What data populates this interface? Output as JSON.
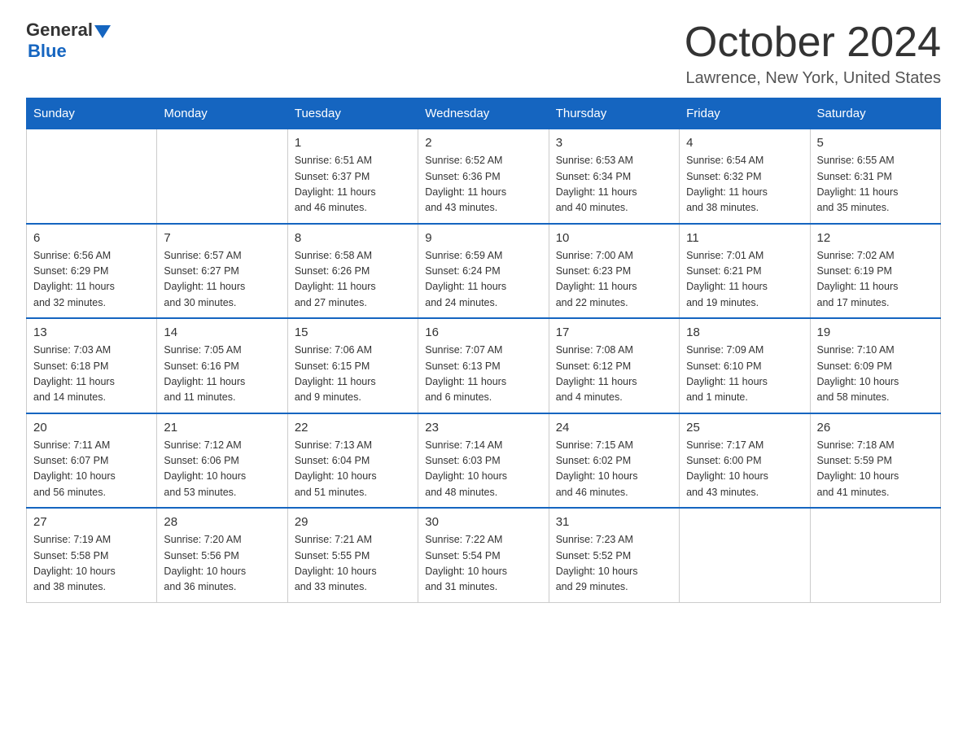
{
  "header": {
    "logo_general": "General",
    "logo_blue": "Blue",
    "month_title": "October 2024",
    "location": "Lawrence, New York, United States"
  },
  "calendar": {
    "days_of_week": [
      "Sunday",
      "Monday",
      "Tuesday",
      "Wednesday",
      "Thursday",
      "Friday",
      "Saturday"
    ],
    "weeks": [
      [
        {
          "day": "",
          "info": ""
        },
        {
          "day": "",
          "info": ""
        },
        {
          "day": "1",
          "info": "Sunrise: 6:51 AM\nSunset: 6:37 PM\nDaylight: 11 hours\nand 46 minutes."
        },
        {
          "day": "2",
          "info": "Sunrise: 6:52 AM\nSunset: 6:36 PM\nDaylight: 11 hours\nand 43 minutes."
        },
        {
          "day": "3",
          "info": "Sunrise: 6:53 AM\nSunset: 6:34 PM\nDaylight: 11 hours\nand 40 minutes."
        },
        {
          "day": "4",
          "info": "Sunrise: 6:54 AM\nSunset: 6:32 PM\nDaylight: 11 hours\nand 38 minutes."
        },
        {
          "day": "5",
          "info": "Sunrise: 6:55 AM\nSunset: 6:31 PM\nDaylight: 11 hours\nand 35 minutes."
        }
      ],
      [
        {
          "day": "6",
          "info": "Sunrise: 6:56 AM\nSunset: 6:29 PM\nDaylight: 11 hours\nand 32 minutes."
        },
        {
          "day": "7",
          "info": "Sunrise: 6:57 AM\nSunset: 6:27 PM\nDaylight: 11 hours\nand 30 minutes."
        },
        {
          "day": "8",
          "info": "Sunrise: 6:58 AM\nSunset: 6:26 PM\nDaylight: 11 hours\nand 27 minutes."
        },
        {
          "day": "9",
          "info": "Sunrise: 6:59 AM\nSunset: 6:24 PM\nDaylight: 11 hours\nand 24 minutes."
        },
        {
          "day": "10",
          "info": "Sunrise: 7:00 AM\nSunset: 6:23 PM\nDaylight: 11 hours\nand 22 minutes."
        },
        {
          "day": "11",
          "info": "Sunrise: 7:01 AM\nSunset: 6:21 PM\nDaylight: 11 hours\nand 19 minutes."
        },
        {
          "day": "12",
          "info": "Sunrise: 7:02 AM\nSunset: 6:19 PM\nDaylight: 11 hours\nand 17 minutes."
        }
      ],
      [
        {
          "day": "13",
          "info": "Sunrise: 7:03 AM\nSunset: 6:18 PM\nDaylight: 11 hours\nand 14 minutes."
        },
        {
          "day": "14",
          "info": "Sunrise: 7:05 AM\nSunset: 6:16 PM\nDaylight: 11 hours\nand 11 minutes."
        },
        {
          "day": "15",
          "info": "Sunrise: 7:06 AM\nSunset: 6:15 PM\nDaylight: 11 hours\nand 9 minutes."
        },
        {
          "day": "16",
          "info": "Sunrise: 7:07 AM\nSunset: 6:13 PM\nDaylight: 11 hours\nand 6 minutes."
        },
        {
          "day": "17",
          "info": "Sunrise: 7:08 AM\nSunset: 6:12 PM\nDaylight: 11 hours\nand 4 minutes."
        },
        {
          "day": "18",
          "info": "Sunrise: 7:09 AM\nSunset: 6:10 PM\nDaylight: 11 hours\nand 1 minute."
        },
        {
          "day": "19",
          "info": "Sunrise: 7:10 AM\nSunset: 6:09 PM\nDaylight: 10 hours\nand 58 minutes."
        }
      ],
      [
        {
          "day": "20",
          "info": "Sunrise: 7:11 AM\nSunset: 6:07 PM\nDaylight: 10 hours\nand 56 minutes."
        },
        {
          "day": "21",
          "info": "Sunrise: 7:12 AM\nSunset: 6:06 PM\nDaylight: 10 hours\nand 53 minutes."
        },
        {
          "day": "22",
          "info": "Sunrise: 7:13 AM\nSunset: 6:04 PM\nDaylight: 10 hours\nand 51 minutes."
        },
        {
          "day": "23",
          "info": "Sunrise: 7:14 AM\nSunset: 6:03 PM\nDaylight: 10 hours\nand 48 minutes."
        },
        {
          "day": "24",
          "info": "Sunrise: 7:15 AM\nSunset: 6:02 PM\nDaylight: 10 hours\nand 46 minutes."
        },
        {
          "day": "25",
          "info": "Sunrise: 7:17 AM\nSunset: 6:00 PM\nDaylight: 10 hours\nand 43 minutes."
        },
        {
          "day": "26",
          "info": "Sunrise: 7:18 AM\nSunset: 5:59 PM\nDaylight: 10 hours\nand 41 minutes."
        }
      ],
      [
        {
          "day": "27",
          "info": "Sunrise: 7:19 AM\nSunset: 5:58 PM\nDaylight: 10 hours\nand 38 minutes."
        },
        {
          "day": "28",
          "info": "Sunrise: 7:20 AM\nSunset: 5:56 PM\nDaylight: 10 hours\nand 36 minutes."
        },
        {
          "day": "29",
          "info": "Sunrise: 7:21 AM\nSunset: 5:55 PM\nDaylight: 10 hours\nand 33 minutes."
        },
        {
          "day": "30",
          "info": "Sunrise: 7:22 AM\nSunset: 5:54 PM\nDaylight: 10 hours\nand 31 minutes."
        },
        {
          "day": "31",
          "info": "Sunrise: 7:23 AM\nSunset: 5:52 PM\nDaylight: 10 hours\nand 29 minutes."
        },
        {
          "day": "",
          "info": ""
        },
        {
          "day": "",
          "info": ""
        }
      ]
    ]
  }
}
